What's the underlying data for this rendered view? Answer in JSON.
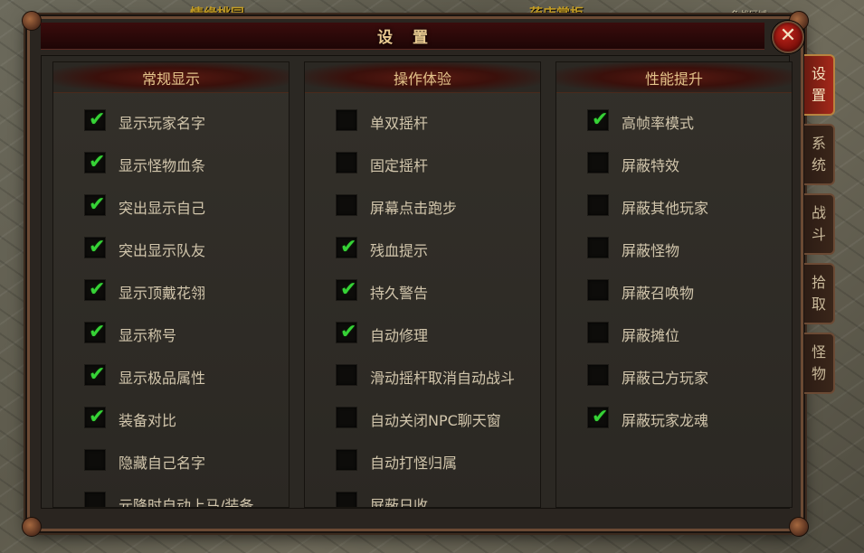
{
  "background": {
    "labels": [
      "情缘桃园",
      "药店掌柜",
      "免战区域"
    ]
  },
  "window": {
    "title": "设置",
    "close_label": "✕"
  },
  "columns": [
    {
      "header": "常规显示",
      "items": [
        {
          "label": "显示玩家名字",
          "checked": true
        },
        {
          "label": "显示怪物血条",
          "checked": true
        },
        {
          "label": "突出显示自己",
          "checked": true
        },
        {
          "label": "突出显示队友",
          "checked": true
        },
        {
          "label": "显示顶戴花翎",
          "checked": true
        },
        {
          "label": "显示称号",
          "checked": true
        },
        {
          "label": "显示极品属性",
          "checked": true
        },
        {
          "label": "装备对比",
          "checked": true
        },
        {
          "label": "隐藏自己名字",
          "checked": false
        },
        {
          "label": "元降时自动上马/装备",
          "checked": false
        }
      ]
    },
    {
      "header": "操作体验",
      "items": [
        {
          "label": "单双摇杆",
          "checked": false
        },
        {
          "label": "固定摇杆",
          "checked": false
        },
        {
          "label": "屏幕点击跑步",
          "checked": false
        },
        {
          "label": "残血提示",
          "checked": true
        },
        {
          "label": "持久警告",
          "checked": true
        },
        {
          "label": "自动修理",
          "checked": true
        },
        {
          "label": "滑动摇杆取消自动战斗",
          "checked": false
        },
        {
          "label": "自动关闭NPC聊天窗",
          "checked": false
        },
        {
          "label": "自动打怪归属",
          "checked": false
        },
        {
          "label": "屏蔽日收",
          "checked": false
        }
      ]
    },
    {
      "header": "性能提升",
      "items": [
        {
          "label": "高帧率模式",
          "checked": true
        },
        {
          "label": "屏蔽特效",
          "checked": false
        },
        {
          "label": "屏蔽其他玩家",
          "checked": false
        },
        {
          "label": "屏蔽怪物",
          "checked": false
        },
        {
          "label": "屏蔽召唤物",
          "checked": false
        },
        {
          "label": "屏蔽摊位",
          "checked": false
        },
        {
          "label": "屏蔽己方玩家",
          "checked": false
        },
        {
          "label": "屏蔽玩家龙魂",
          "checked": true
        }
      ]
    }
  ],
  "tabs": [
    {
      "chars": [
        "设",
        "置"
      ],
      "active": true
    },
    {
      "chars": [
        "系",
        "统"
      ],
      "active": false
    },
    {
      "chars": [
        "战",
        "斗"
      ],
      "active": false
    },
    {
      "chars": [
        "拾",
        "取"
      ],
      "active": false
    },
    {
      "chars": [
        "怪",
        "物"
      ],
      "active": false
    }
  ],
  "check_glyph": "✔",
  "colors": {
    "check": "#36d236",
    "title_bar": "#3a0c0c",
    "active_tab": "#a5281a",
    "label_text": "#d2c6ac",
    "header_text": "#e3c38a"
  }
}
